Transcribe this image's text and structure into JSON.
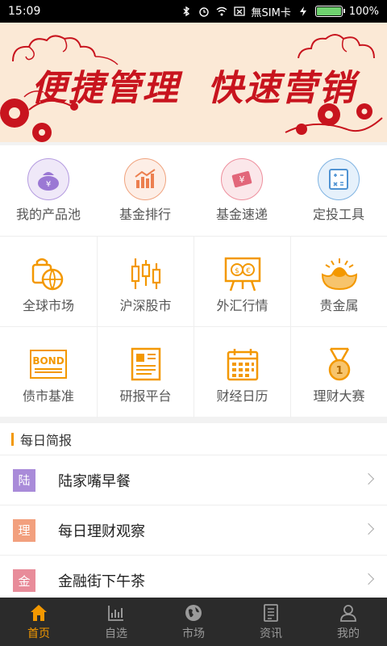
{
  "status_bar": {
    "time": "15:09",
    "carrier": "無SIM卡",
    "battery": "100%",
    "battery_level": 1.0,
    "icons": [
      "bluetooth-icon",
      "alarm-icon",
      "wifi-icon",
      "no-sim-icon",
      "charging-icon",
      "battery-icon"
    ]
  },
  "banner": {
    "title": "便捷管理  快速营销",
    "colors": {
      "background": "#fbe9d6",
      "accent": "#c8141e"
    }
  },
  "grid": {
    "row1": [
      {
        "label": "我的产品池",
        "icon": "product-pool-icon"
      },
      {
        "label": "基金排行",
        "icon": "fund-ranking-icon"
      },
      {
        "label": "基金速递",
        "icon": "fund-express-icon"
      },
      {
        "label": "定投工具",
        "icon": "calculator-icon"
      }
    ],
    "row2": [
      {
        "label": "全球市场",
        "icon": "globe-icon"
      },
      {
        "label": "沪深股市",
        "icon": "candlestick-icon"
      },
      {
        "label": "外汇行情",
        "icon": "forex-icon"
      },
      {
        "label": "贵金属",
        "icon": "gold-ingot-icon"
      }
    ],
    "row3": [
      {
        "label": "债市基准",
        "icon": "bond-icon",
        "icon_text": "BOND"
      },
      {
        "label": "研报平台",
        "icon": "research-report-icon"
      },
      {
        "label": "财经日历",
        "icon": "calendar-icon"
      },
      {
        "label": "理财大赛",
        "icon": "medal-icon",
        "icon_text": "1"
      }
    ]
  },
  "brief": {
    "title": "每日简报",
    "items": [
      {
        "badge": "陆",
        "label": "陆家嘴早餐",
        "color": "#a98bd9"
      },
      {
        "badge": "理",
        "label": "每日理财观察",
        "color": "#f2a07e"
      },
      {
        "badge": "金",
        "label": "金融街下午茶",
        "color": "#e88c9a"
      }
    ]
  },
  "bottom_nav": {
    "items": [
      {
        "label": "首页",
        "icon": "home-icon",
        "active": true
      },
      {
        "label": "自选",
        "icon": "chart-icon",
        "active": false
      },
      {
        "label": "市场",
        "icon": "globe-icon",
        "active": false
      },
      {
        "label": "资讯",
        "icon": "news-icon",
        "active": false
      },
      {
        "label": "我的",
        "icon": "profile-icon",
        "active": false
      }
    ],
    "colors": {
      "active": "#f39800",
      "inactive": "#9a9a9a",
      "background": "#2b2b2b"
    }
  }
}
